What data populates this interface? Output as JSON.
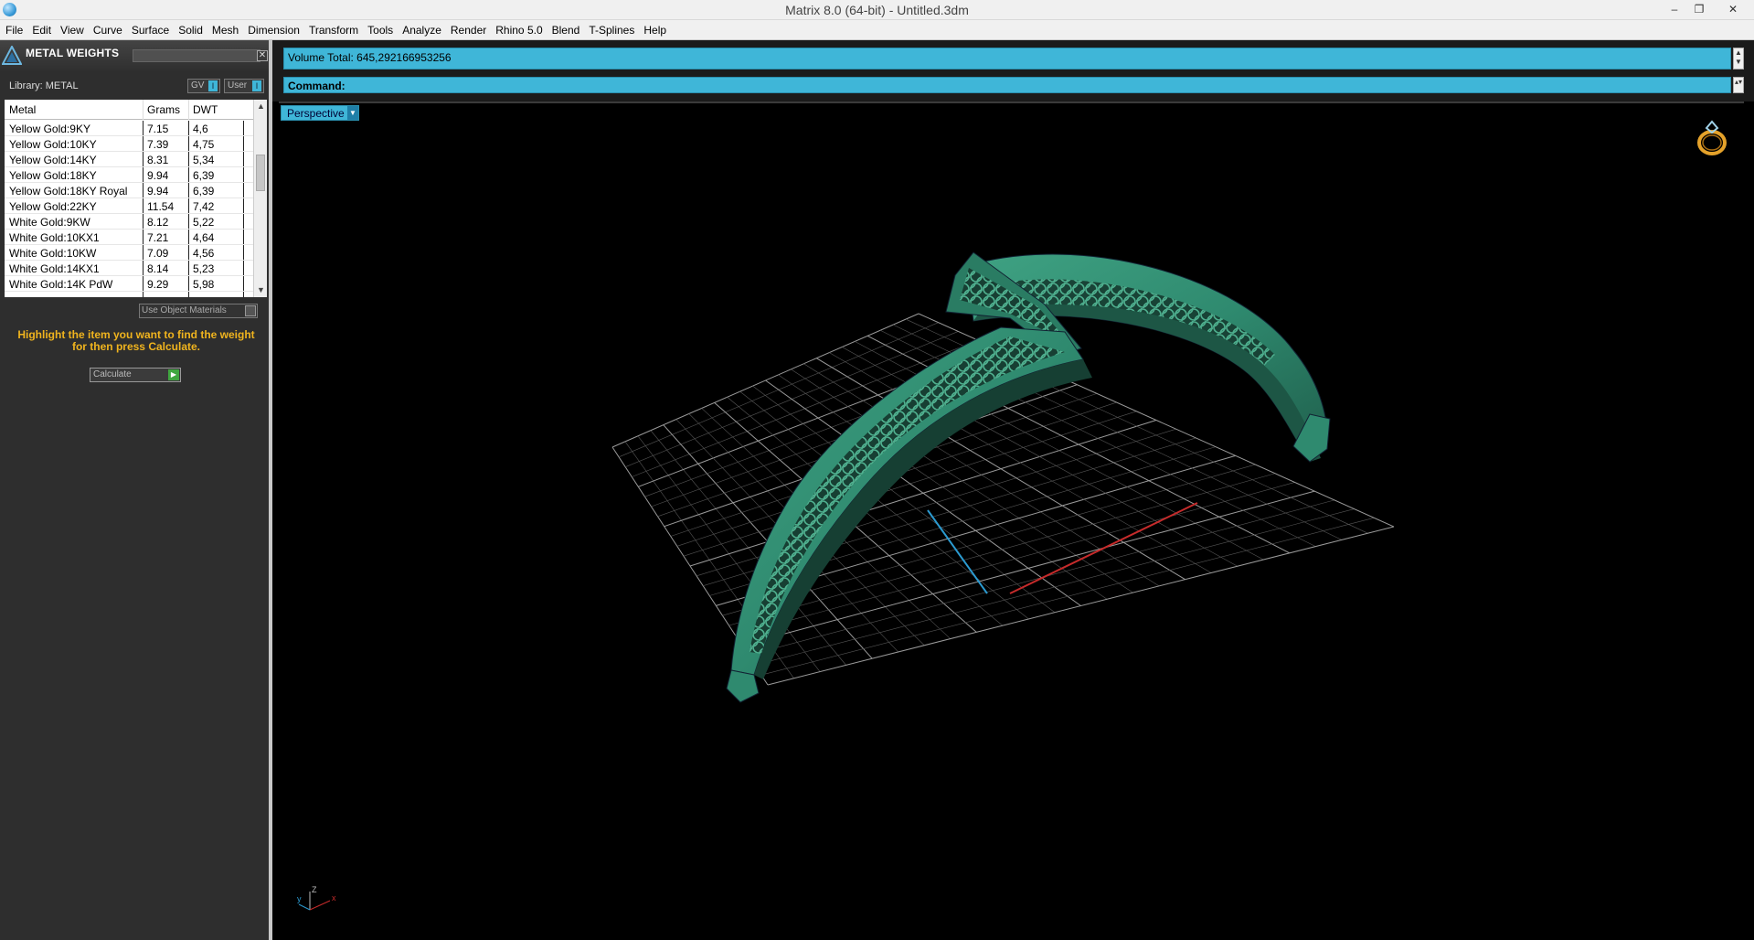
{
  "window": {
    "title": "Matrix 8.0 (64-bit) - Untitled.3dm",
    "min_glyph": "–",
    "max_glyph": "❐",
    "close_glyph": "✕"
  },
  "menu": [
    "File",
    "Edit",
    "View",
    "Curve",
    "Surface",
    "Solid",
    "Mesh",
    "Dimension",
    "Transform",
    "Tools",
    "Analyze",
    "Render",
    "Rhino 5.0",
    "Blend",
    "T-Splines",
    "Help"
  ],
  "panel": {
    "title": "METAL WEIGHTS",
    "close_glyph": "✕",
    "library_label": "Library: METAL",
    "toggle_gv": "GV",
    "toggle_user": "User",
    "toggle_indicator": "I",
    "table": {
      "headers": [
        "Metal",
        "Grams",
        "DWT"
      ],
      "rows": [
        [
          "Yellow Gold:9KY",
          "7.15",
          "4,6"
        ],
        [
          "Yellow Gold:10KY",
          "7.39",
          "4,75"
        ],
        [
          "Yellow Gold:14KY",
          "8.31",
          "5,34"
        ],
        [
          "Yellow Gold:18KY",
          "9.94",
          "6,39"
        ],
        [
          "Yellow Gold:18KY Royal",
          "9.94",
          "6,39"
        ],
        [
          "Yellow Gold:22KY",
          "11.54",
          "7,42"
        ],
        [
          "White Gold:9KW",
          "8.12",
          "5,22"
        ],
        [
          "White Gold:10KX1",
          "7.21",
          "4,64"
        ],
        [
          "White Gold:10KW",
          "7.09",
          "4,56"
        ],
        [
          "White Gold:14KX1",
          "8.14",
          "5,23"
        ],
        [
          "White Gold:14K PdW",
          "9.29",
          "5,98"
        ]
      ]
    },
    "use_object_materials": "Use Object Materials",
    "hint": "Highlight the item you want to find the weight for then press Calculate.",
    "calculate_label": "Calculate",
    "calculate_glyph": "▶"
  },
  "command": {
    "volume_text": "Volume Total: 645,292166953256",
    "command_label": "Command:"
  },
  "viewport": {
    "view_name": "Perspective",
    "dropdown_glyph": "▼",
    "axis_labels": {
      "z": "Z",
      "y": "y",
      "x": "x"
    },
    "colors": {
      "model": "#2f8a6f",
      "grid": "#7a7a7a",
      "x_axis": "#c62b2b",
      "y_axis": "#2b9ad0",
      "accent": "#3fb6d8"
    }
  },
  "colors": {
    "accent": "#3fb6d8",
    "panel_bg": "#2e2e2e",
    "hint": "#f0b41e"
  }
}
